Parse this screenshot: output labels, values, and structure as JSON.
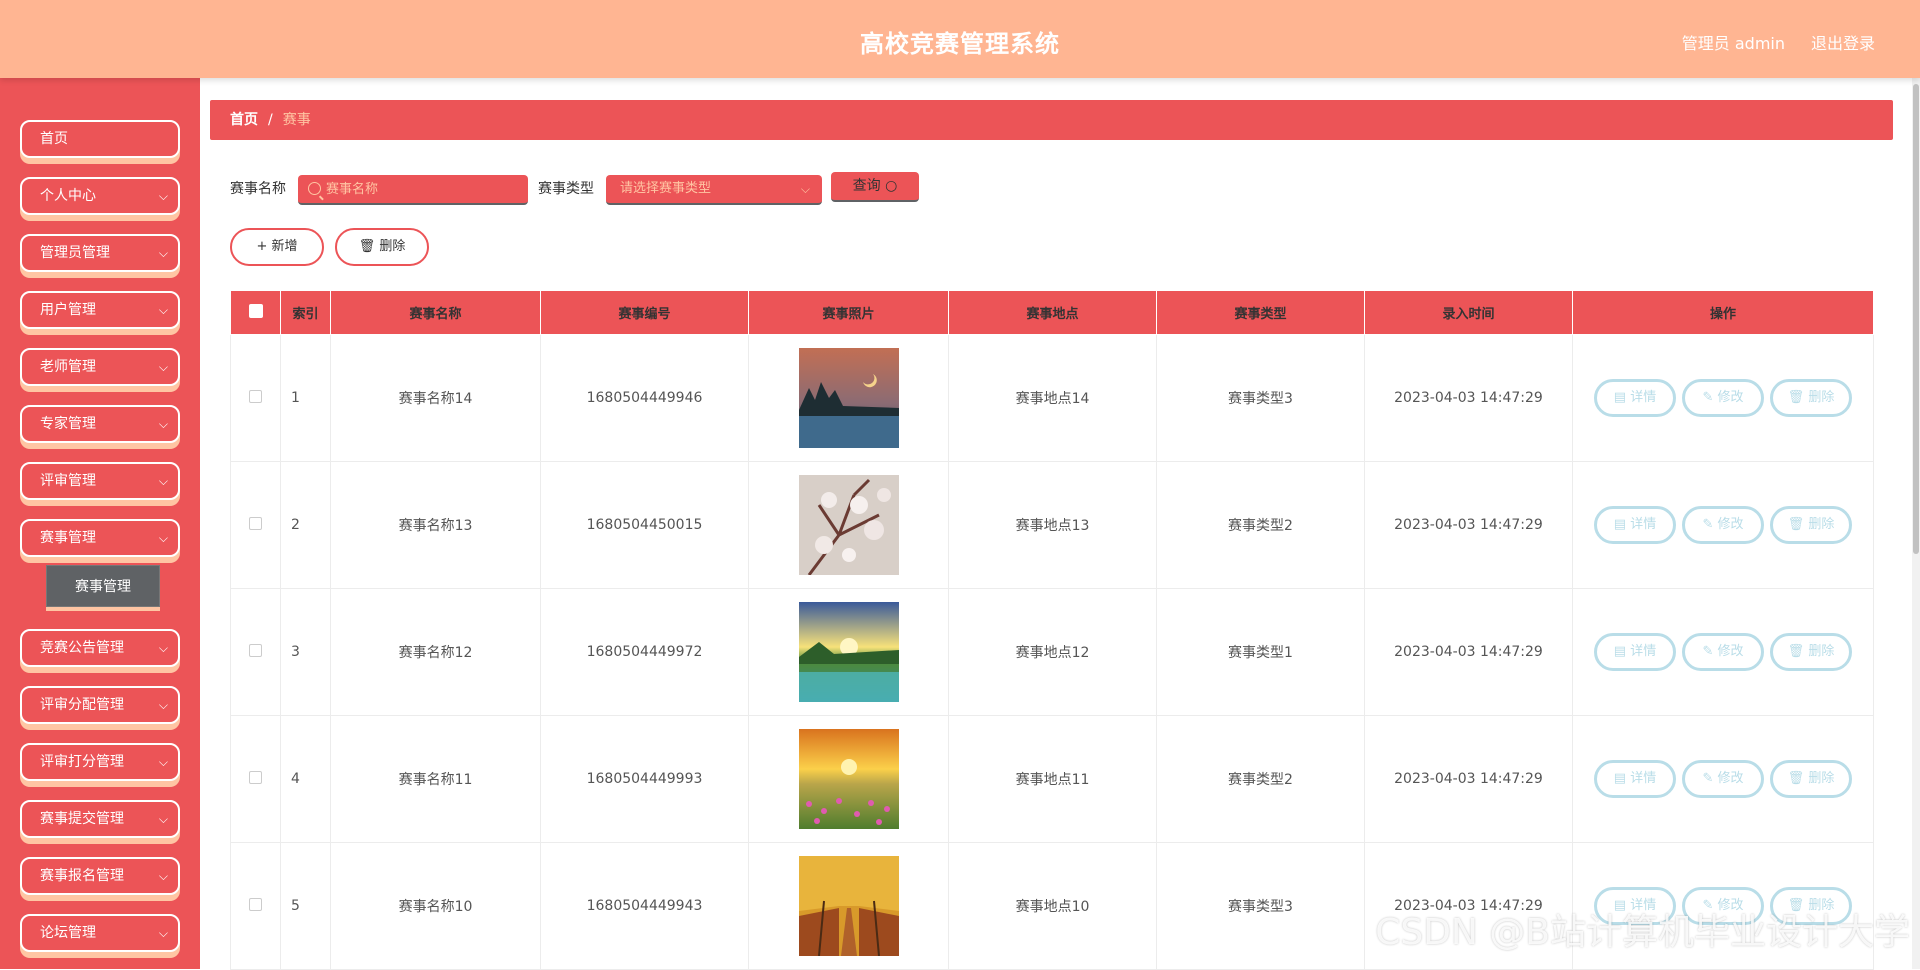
{
  "header": {
    "title": "高校竞赛管理系统",
    "user": "管理员 admin",
    "logout": "退出登录"
  },
  "sidebar": {
    "items": [
      {
        "label": "首页",
        "has_children": false
      },
      {
        "label": "个人中心",
        "has_children": true
      },
      {
        "label": "管理员管理",
        "has_children": true
      },
      {
        "label": "用户管理",
        "has_children": true
      },
      {
        "label": "老师管理",
        "has_children": true
      },
      {
        "label": "专家管理",
        "has_children": true
      },
      {
        "label": "评审管理",
        "has_children": true
      },
      {
        "label": "赛事管理",
        "has_children": true
      },
      {
        "label": "竞赛公告管理",
        "has_children": true
      },
      {
        "label": "评审分配管理",
        "has_children": true
      },
      {
        "label": "评审打分管理",
        "has_children": true
      },
      {
        "label": "赛事提交管理",
        "has_children": true
      },
      {
        "label": "赛事报名管理",
        "has_children": true
      },
      {
        "label": "论坛管理",
        "has_children": true
      }
    ],
    "submenu": {
      "label": "赛事管理"
    },
    "chevron": "chevron-down-icon"
  },
  "breadcrumb": {
    "home": "首页",
    "sep": "/",
    "current": "赛事"
  },
  "search": {
    "name_label": "赛事名称",
    "name_placeholder": "赛事名称",
    "type_label": "赛事类型",
    "type_placeholder": "请选择赛事类型",
    "query_label": "查询"
  },
  "actions": {
    "add": "新增",
    "delete": "删除"
  },
  "table": {
    "columns": [
      "索引",
      "赛事名称",
      "赛事编号",
      "赛事照片",
      "赛事地点",
      "赛事类型",
      "录入时间",
      "操作"
    ],
    "rows": [
      {
        "index": "1",
        "name": "赛事名称14",
        "code": "1680504449946",
        "photo": "lake-night",
        "place": "赛事地点14",
        "type": "赛事类型3",
        "time": "2023-04-03 14:47:29"
      },
      {
        "index": "2",
        "name": "赛事名称13",
        "code": "1680504450015",
        "photo": "blossom",
        "place": "赛事地点13",
        "type": "赛事类型2",
        "time": "2023-04-03 14:47:29"
      },
      {
        "index": "3",
        "name": "赛事名称12",
        "code": "1680504449972",
        "photo": "sunrise-lake",
        "place": "赛事地点12",
        "type": "赛事类型1",
        "time": "2023-04-03 14:47:29"
      },
      {
        "index": "4",
        "name": "赛事名称11",
        "code": "1680504449993",
        "photo": "flower-field",
        "place": "赛事地点11",
        "type": "赛事类型2",
        "time": "2023-04-03 14:47:29"
      },
      {
        "index": "5",
        "name": "赛事名称10",
        "code": "1680504449943",
        "photo": "autumn-road",
        "place": "赛事地点10",
        "type": "赛事类型3",
        "time": "2023-04-03 14:47:29"
      }
    ],
    "row_actions": {
      "detail": "详情",
      "edit": "修改",
      "delete": "删除"
    }
  },
  "colors": {
    "header": "#ffb592",
    "accent": "#ec5457",
    "shadow": "#ffc5a3",
    "op_button": "#b9dde8"
  },
  "watermark": "CSDN @B站计算机毕业设计大学"
}
